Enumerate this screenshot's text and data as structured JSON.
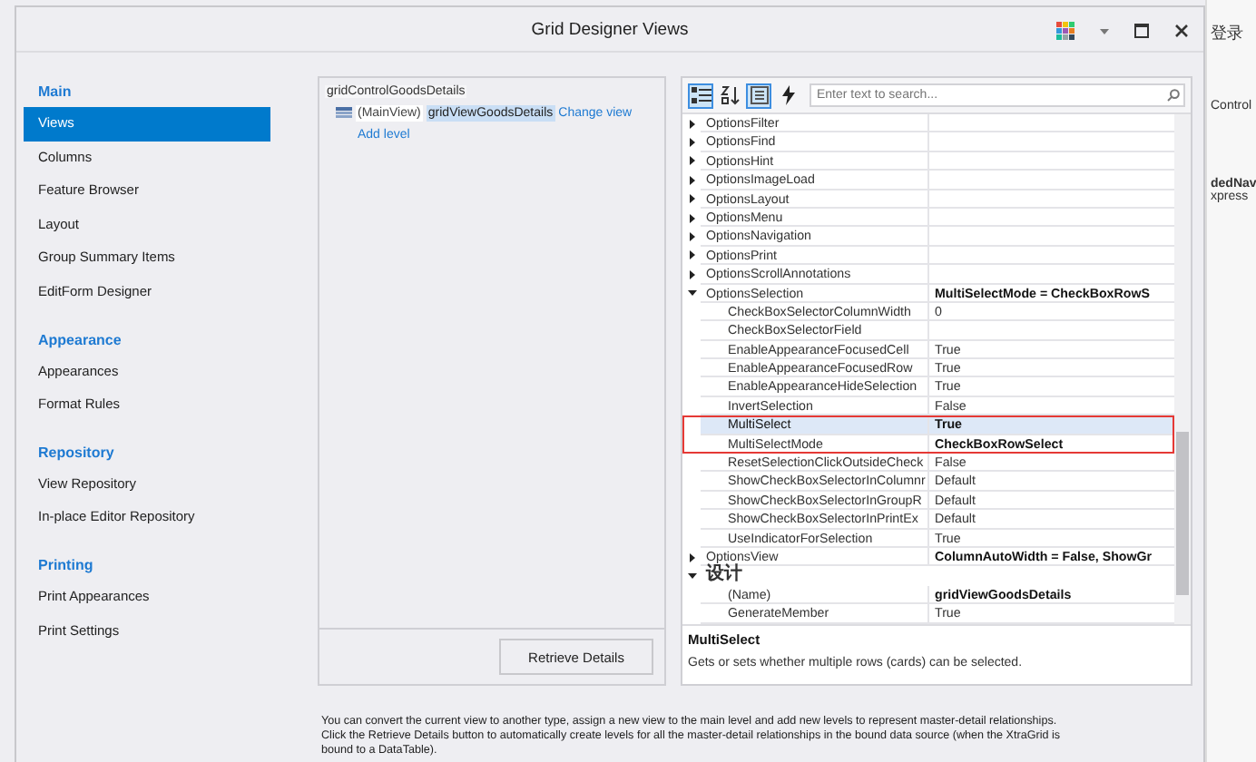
{
  "window": {
    "title": "Grid Designer Views"
  },
  "sidebar": {
    "groups": [
      {
        "heading": "Main",
        "items": [
          {
            "label": "Views",
            "selected": true
          },
          {
            "label": "Columns",
            "selected": false
          },
          {
            "label": "Feature Browser",
            "selected": false
          },
          {
            "label": "Layout",
            "selected": false
          },
          {
            "label": "Group Summary Items",
            "selected": false
          },
          {
            "label": "EditForm Designer",
            "selected": false
          }
        ]
      },
      {
        "heading": "Appearance",
        "items": [
          {
            "label": "Appearances",
            "selected": false
          },
          {
            "label": "Format Rules",
            "selected": false
          }
        ]
      },
      {
        "heading": "Repository",
        "items": [
          {
            "label": "View Repository",
            "selected": false
          },
          {
            "label": "In-place Editor Repository",
            "selected": false
          }
        ]
      },
      {
        "heading": "Printing",
        "items": [
          {
            "label": "Print Appearances",
            "selected": false
          },
          {
            "label": "Print Settings",
            "selected": false
          }
        ]
      }
    ]
  },
  "levels": {
    "grid_name": "gridControlGoodsDetails",
    "main_view": "(MainView)",
    "view_name": "gridViewGoodsDetails",
    "change_link": "Change view",
    "add_link": "Add level",
    "button": "Retrieve Details"
  },
  "property_grid": {
    "toolbar": [
      {
        "kind": "categorized",
        "selected": true
      },
      {
        "kind": "alphabetical",
        "selected": false
      },
      {
        "kind": "properties",
        "selected": true
      },
      {
        "kind": "events",
        "selected": false
      }
    ],
    "search": {
      "placeholder": "Enter text to search..."
    },
    "rows": [
      {
        "kind": "property",
        "name": "OptionsFilter",
        "expanded": false,
        "selected": false,
        "annotated": false
      },
      {
        "kind": "property",
        "name": "OptionsFind",
        "expanded": false,
        "selected": false,
        "annotated": false
      },
      {
        "kind": "property",
        "name": "OptionsHint",
        "expanded": false,
        "selected": false,
        "annotated": false
      },
      {
        "kind": "property",
        "name": "OptionsImageLoad",
        "expanded": false,
        "selected": false,
        "annotated": false
      },
      {
        "kind": "property",
        "name": "OptionsLayout",
        "expanded": false,
        "selected": false,
        "annotated": false
      },
      {
        "kind": "property",
        "name": "OptionsMenu",
        "expanded": false,
        "selected": false,
        "annotated": false
      },
      {
        "kind": "property",
        "name": "OptionsNavigation",
        "expanded": false,
        "selected": false,
        "annotated": false
      },
      {
        "kind": "property",
        "name": "OptionsPrint",
        "expanded": false,
        "selected": false,
        "annotated": false
      },
      {
        "kind": "property",
        "name": "OptionsScrollAnnotations",
        "expanded": false,
        "selected": false,
        "annotated": false
      },
      {
        "kind": "property",
        "name": "OptionsSelection",
        "value": "MultiSelectMode = CheckBoxRowS",
        "expanded": true,
        "selected": false,
        "modified": true,
        "annotated": false,
        "children": [
          {
            "kind": "property",
            "name": "CheckBoxSelectorColumnWidth",
            "value": "0",
            "selected": false,
            "modified": false,
            "annotated": false
          },
          {
            "kind": "property",
            "name": "CheckBoxSelectorField",
            "selected": false,
            "annotated": false
          },
          {
            "kind": "property",
            "name": "EnableAppearanceFocusedCell",
            "value": "True",
            "selected": false,
            "modified": false,
            "annotated": false
          },
          {
            "kind": "property",
            "name": "EnableAppearanceFocusedRow",
            "value": "True",
            "selected": false,
            "modified": false,
            "annotated": false
          },
          {
            "kind": "property",
            "name": "EnableAppearanceHideSelection",
            "value": "True",
            "selected": false,
            "modified": false,
            "annotated": false
          },
          {
            "kind": "property",
            "name": "InvertSelection",
            "value": "False",
            "selected": false,
            "modified": false,
            "annotated": false
          },
          {
            "kind": "property",
            "name": "MultiSelect",
            "value": "True",
            "selected": true,
            "modified": true,
            "annotated": true
          },
          {
            "kind": "property",
            "name": "MultiSelectMode",
            "value": "CheckBoxRowSelect",
            "selected": false,
            "modified": true,
            "annotated": true
          },
          {
            "kind": "property",
            "name": "ResetSelectionClickOutsideCheck",
            "value": "False",
            "selected": false,
            "modified": false,
            "annotated": false
          },
          {
            "kind": "property",
            "name": "ShowCheckBoxSelectorInColumnr",
            "value": "Default",
            "selected": false,
            "modified": false,
            "annotated": false
          },
          {
            "kind": "property",
            "name": "ShowCheckBoxSelectorInGroupR",
            "value": "Default",
            "selected": false,
            "modified": false,
            "annotated": false
          },
          {
            "kind": "property",
            "name": "ShowCheckBoxSelectorInPrintEx",
            "value": "Default",
            "selected": false,
            "modified": false,
            "annotated": false
          },
          {
            "kind": "property",
            "name": "UseIndicatorForSelection",
            "value": "True",
            "selected": false,
            "modified": false,
            "annotated": false
          }
        ]
      },
      {
        "kind": "property",
        "name": "OptionsView",
        "value": "ColumnAutoWidth = False, ShowGr",
        "expanded": false,
        "selected": false,
        "modified": true,
        "annotated": false
      },
      {
        "kind": "category",
        "name": "设计",
        "expanded": true,
        "children": [
          {
            "kind": "property",
            "name": "(Name)",
            "value": "gridViewGoodsDetails",
            "selected": false,
            "modified": true,
            "annotated": false
          },
          {
            "kind": "property",
            "name": "GenerateMember",
            "value": "True",
            "selected": false,
            "modified": false,
            "annotated": false
          }
        ]
      }
    ],
    "description": {
      "title": "MultiSelect",
      "text": "Gets or sets whether multiple rows (cards) can be selected."
    }
  },
  "hint_lines": [
    "You can convert the current view to another type, assign a new view to the main level and add new levels to represent master-detail relationships.",
    "Click the Retrieve Details button to automatically create levels for all the master-detail relationships in the bound data source (when the XtraGrid is",
    "bound to a DataTable)."
  ],
  "background_window": {
    "account": "登录",
    "items": [
      {
        "label": "Control",
        "bold": false
      },
      {
        "label": "dedNav",
        "bold": true
      },
      {
        "label": "xpress",
        "bold": false
      }
    ]
  }
}
